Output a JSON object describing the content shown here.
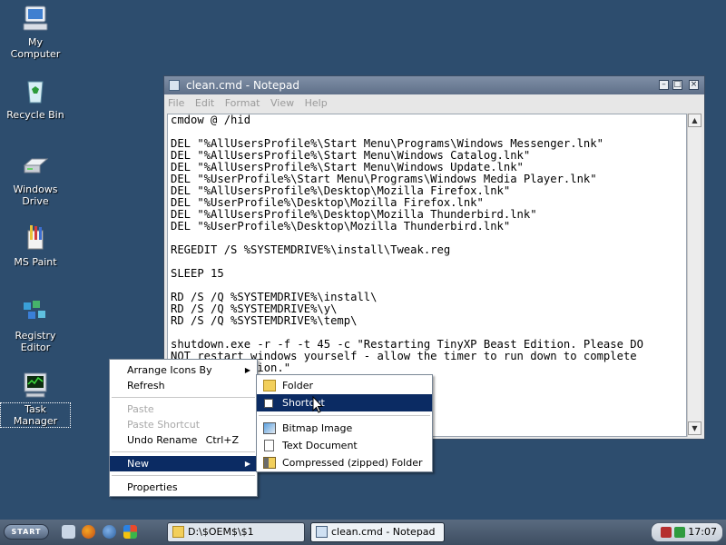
{
  "desktop": {
    "icons": [
      {
        "label": "My Computer",
        "icon": "computer-icon"
      },
      {
        "label": "Recycle Bin",
        "icon": "recycle-bin-icon"
      },
      {
        "label": "Windows Drive",
        "icon": "drive-icon"
      },
      {
        "label": "MS Paint",
        "icon": "paint-icon"
      },
      {
        "label": "Registry Editor",
        "icon": "registry-icon"
      },
      {
        "label": "Task Manager",
        "icon": "task-manager-icon"
      }
    ]
  },
  "notepad": {
    "title": "clean.cmd - Notepad",
    "menu": [
      "File",
      "Edit",
      "Format",
      "View",
      "Help"
    ],
    "content": "cmdow @ /hid\n\nDEL \"%AllUsersProfile%\\Start Menu\\Programs\\Windows Messenger.lnk\"\nDEL \"%AllUsersProfile%\\Start Menu\\Windows Catalog.lnk\"\nDEL \"%AllUsersProfile%\\Start Menu\\Windows Update.lnk\"\nDEL \"%UserProfile%\\Start Menu\\Programs\\Windows Media Player.lnk\"\nDEL \"%AllUsersProfile%\\Desktop\\Mozilla Firefox.lnk\"\nDEL \"%UserProfile%\\Desktop\\Mozilla Firefox.lnk\"\nDEL \"%AllUsersProfile%\\Desktop\\Mozilla Thunderbird.lnk\"\nDEL \"%UserProfile%\\Desktop\\Mozilla Thunderbird.lnk\"\n\nREGEDIT /S %SYSTEMDRIVE%\\install\\Tweak.reg\n\nSLEEP 15\n\nRD /S /Q %SYSTEMDRIVE%\\install\\\nRD /S /Q %SYSTEMDRIVE%\\y\\\nRD /S /Q %SYSTEMDRIVE%\\temp\\\n\nshutdown.exe -r -f -t 45 -c \"Restarting TinyXP Beast Edition. Please DO\nNOT restart windows yourself - allow the timer to run down to complete\nthe installation.\""
  },
  "context_menu": {
    "items": [
      {
        "label": "Arrange Icons By",
        "submenu": true
      },
      {
        "label": "Refresh"
      },
      {
        "label": "Paste",
        "disabled": true
      },
      {
        "label": "Paste Shortcut",
        "disabled": true
      },
      {
        "label": "Undo Rename",
        "accel": "Ctrl+Z"
      },
      {
        "label": "New",
        "submenu": true,
        "highlighted": true
      },
      {
        "label": "Properties"
      }
    ]
  },
  "new_submenu": {
    "items": [
      {
        "label": "Folder",
        "icon": "folder-icon"
      },
      {
        "label": "Shortcut",
        "icon": "shortcut-icon",
        "highlighted": true
      },
      {
        "label": "Bitmap Image",
        "icon": "bitmap-icon"
      },
      {
        "label": "Text Document",
        "icon": "text-document-icon"
      },
      {
        "label": "Compressed (zipped) Folder",
        "icon": "zip-folder-icon"
      }
    ]
  },
  "taskbar": {
    "start_label": "START",
    "quick_launch": [
      "show-desktop-icon",
      "firefox-icon",
      "thunderbird-icon",
      "windows-flag-icon"
    ],
    "tasks": [
      {
        "label": "D:\\$OEM$\\$1",
        "icon": "folder-icon",
        "active": false
      },
      {
        "label": "clean.cmd - Notepad",
        "icon": "notepad-icon",
        "active": true
      }
    ],
    "clock": "17:07"
  },
  "colors": {
    "desktop_bg": "#2d4d6e",
    "menu_highlight": "#0b2b63",
    "titlebar": "#6f7f98"
  }
}
